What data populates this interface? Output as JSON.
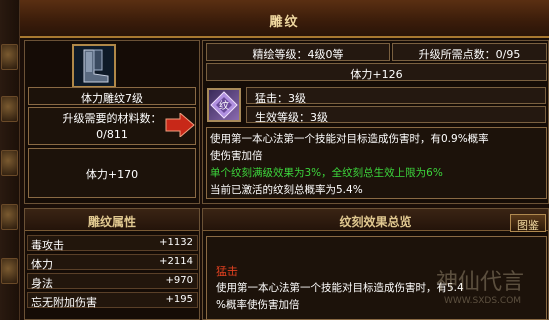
{
  "window": {
    "title": "雕纹"
  },
  "left_panel": {
    "item_name": "体力雕纹7级",
    "materials_label": "升级需要的材料数：",
    "materials_value": "0/811",
    "stat": "体力+170"
  },
  "right_panel": {
    "refine_level": "精绘等级：4级0等",
    "upgrade_points": "升级所需点数：0/95",
    "stat_bonus": "体力+126",
    "gem_attack": "猛击：3级",
    "gem_effect_level": "生效等级：3级",
    "description": {
      "line1": "使用第一本心法第一个技能对目标造成伤害时，有0.9%概率",
      "line2": "使伤害加倍",
      "line3": "单个纹刻满级效果为3%，全纹刻总生效上限为6%",
      "line4": "当前已激活的纹刻总概率为5.4%"
    }
  },
  "attributes": {
    "header": "雕纹属性",
    "rows": [
      {
        "name": "毒攻击",
        "value": "+1132"
      },
      {
        "name": "体力",
        "value": "+2114"
      },
      {
        "name": "身法",
        "value": "+970"
      },
      {
        "name": "忘无附加伤害",
        "value": "+195"
      }
    ]
  },
  "effects": {
    "header": "纹刻效果总览",
    "button": "图鉴",
    "entry_title": "猛击",
    "entry_line1": "使用第一本心法第一个技能对目标造成伤害时，有5.4",
    "entry_line2": "%概率使伤害加倍"
  },
  "watermark": {
    "text": "神仙代言",
    "url": "WWW.SXDS.COM"
  },
  "colors": {
    "accent_gold": "#a87830",
    "green_text": "#3cd63c",
    "red_text": "#e04020",
    "panel_bg": "#150c06"
  },
  "icons": {
    "item": "boots-icon",
    "arrow": "arrow-right-icon",
    "gem": "engraving-gem-icon"
  }
}
